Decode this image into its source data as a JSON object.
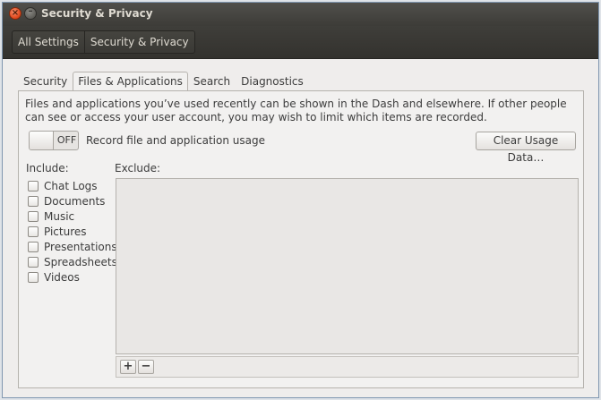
{
  "window": {
    "title": "Security & Privacy"
  },
  "breadcrumbs": [
    "All Settings",
    "Security & Privacy"
  ],
  "tabs": [
    {
      "label": "Security",
      "active": false
    },
    {
      "label": "Files & Applications",
      "active": true
    },
    {
      "label": "Search",
      "active": false
    },
    {
      "label": "Diagnostics",
      "active": false
    }
  ],
  "description": "Files and applications you’ve used recently can be shown in the Dash and elsewhere. If other people can see or access your user account, you may wish to limit which items are recorded.",
  "recording": {
    "switch_state": "OFF",
    "label": "Record file and application usage"
  },
  "clear_button": "Clear Usage Data…",
  "include": {
    "label": "Include:",
    "items": [
      "Chat Logs",
      "Documents",
      "Music",
      "Pictures",
      "Presentations",
      "Spreadsheets",
      "Videos"
    ]
  },
  "exclude": {
    "label": "Exclude:",
    "add": "+",
    "remove": "−"
  },
  "colors": {
    "accent_close": "#e1481d",
    "titlebar": "#3d3c38",
    "panel_bg": "#f2f1f0"
  }
}
